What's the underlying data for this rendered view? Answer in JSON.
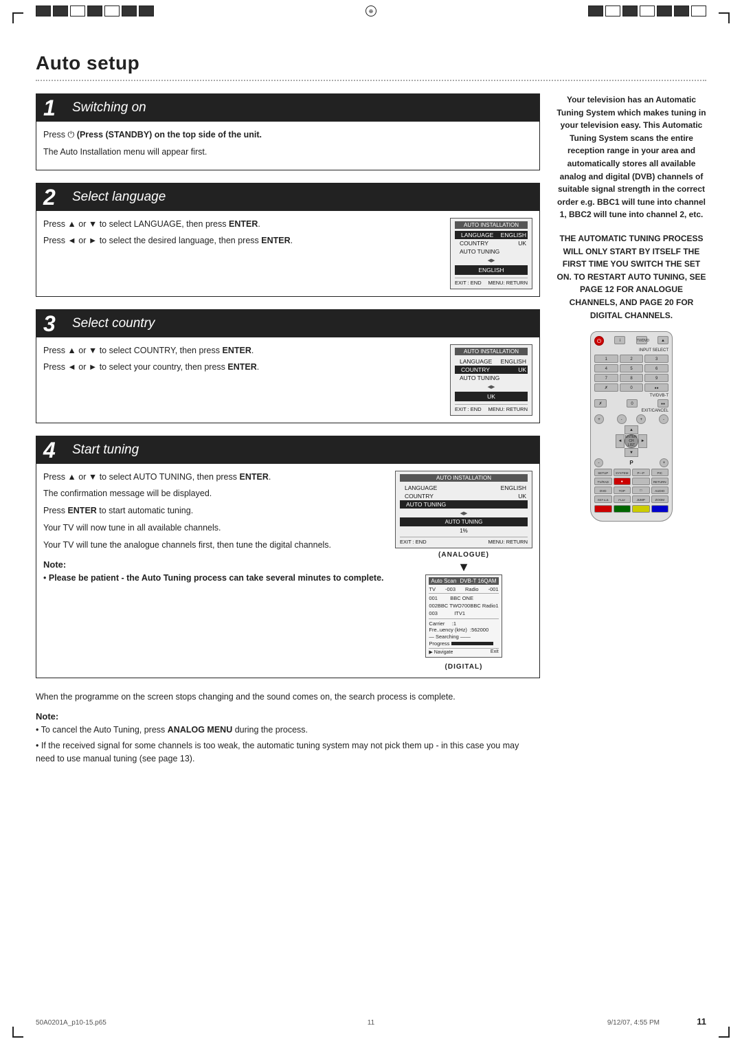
{
  "page": {
    "title": "Auto setup",
    "page_number": "11",
    "footer_left": "50A0201A_p10-15.p65",
    "footer_center": "11",
    "footer_right_date": "9/12/07, 4:55 PM"
  },
  "steps": [
    {
      "number": "1",
      "title": "Switching on",
      "text_lines": [
        "Press  (STANDBY) on the top side of the unit.",
        "The Auto Installation menu will appear first."
      ]
    },
    {
      "number": "2",
      "title": "Select language",
      "text_lines": [
        "Press ▲ or ▼ to select LANGUAGE, then press ENTER.",
        "Press ◄ or ► to select the desired language, then press ENTER."
      ],
      "screen": {
        "title": "AUTO INSTALLATION",
        "rows": [
          {
            "label": "LANGUAGE",
            "value": "ENGLISH",
            "active": true
          },
          {
            "label": "COUNTRY",
            "value": "UK",
            "active": false
          },
          {
            "label": "AUTO TUNING",
            "value": "",
            "active": false
          }
        ],
        "selection": "ENGLISH",
        "footer": [
          "EXIT : END",
          "MENU: RETURN"
        ]
      }
    },
    {
      "number": "3",
      "title": "Select country",
      "text_lines": [
        "Press ▲ or ▼ to select COUNTRY, then press ENTER.",
        "Press ◄ or ► to select your country, then press ENTER."
      ],
      "screen": {
        "title": "AUTO INSTALLATION",
        "rows": [
          {
            "label": "LANGUAGE",
            "value": "ENGLISH",
            "active": false
          },
          {
            "label": "COUNTRY",
            "value": "UK",
            "active": true
          },
          {
            "label": "AUTO TUNING",
            "value": "",
            "active": false
          }
        ],
        "selection": "UK",
        "footer": [
          "EXIT : END",
          "MENU: RETURN"
        ]
      }
    },
    {
      "number": "4",
      "title": "Start tuning",
      "text_lines_before": [
        "Press ▲ or ▼ to select AUTO TUNING, then press ENTER.",
        "The confirmation message will be displayed.",
        "Press ENTER to start automatic tuning.",
        "Your TV will now tune in all available channels.",
        "Your TV will tune the analogue channels first, then tune the digital channels."
      ],
      "note_title": "Note:",
      "note_items": [
        "Please be patient - the Auto Tuning process can take several minutes to complete."
      ],
      "screen_step4": {
        "title": "AUTO INSTALLATION",
        "rows": [
          {
            "label": "LANGUAGE",
            "value": "ENGLISH",
            "active": false
          },
          {
            "label": "COUNTRY",
            "value": "UK",
            "active": false
          },
          {
            "label": "AUTO TUNING",
            "value": "",
            "active": true
          }
        ],
        "autotuning_bar": "AUTO TUNING",
        "percent": "1%",
        "footer": [
          "EXIT : END",
          "MENU: RETURN"
        ]
      },
      "analogue_label": "(ANALOGUE)",
      "digital_label": "(DIGITAL)",
      "autoscan": {
        "title": "Auto Scan",
        "subtitle": "DVB-T 16QAM",
        "cols": [
          "TV",
          "-003",
          "Radio",
          "-001"
        ],
        "rows": [
          [
            "001",
            "BBC ONE",
            "",
            ""
          ],
          [
            "002",
            "BBC TWO",
            "700",
            "BBC Radio1"
          ],
          [
            "003",
            "ITV1",
            "",
            ""
          ]
        ],
        "carrier": "Carrier         :1",
        "frequency": "Fre..uency (kHz)  :562000",
        "searching": "Searching",
        "progress_label": "Progress",
        "navigate": "Navigate",
        "exit_label": "Exit"
      }
    }
  ],
  "bottom_notes": {
    "title": "Note:",
    "items": [
      "To cancel the Auto Tuning, press ANALOG MENU during the process.",
      "If the received signal for some channels is too weak, the automatic tuning system may not pick them up - in this case you may need to use manual tuning (see page 13)."
    ],
    "text_after": "When the programme on the screen stops changing and the sound comes on, the search process is complete."
  },
  "right_col": {
    "description": "Your television has an Automatic Tuning System which makes tuning in your television easy. This Automatic Tuning System scans the entire reception range in your area and automatically stores all available analog and digital (DVB) channels of suitable signal strength in the correct order e.g. BBC1 will tune into channel 1, BBC2 will tune into channel 2, etc.",
    "bold_text": "THE AUTOMATIC TUNING PROCESS WILL ONLY START BY ITSELF THE FIRST TIME YOU SWITCH THE SET ON. TO RESTART AUTO TUNING, SEE PAGE 12 FOR ANALOGUE CHANNELS, AND PAGE 20 FOR DIGITAL CHANNELS.",
    "remote_buttons": {
      "top": [
        "TV/DVD",
        "▲"
      ],
      "row1": [
        "●",
        "i",
        "TV/DVD",
        "▲"
      ],
      "numpad": [
        "1",
        "2",
        "3",
        "4",
        "5",
        "6",
        "7",
        "8",
        "9",
        "✗",
        "0",
        "●●"
      ],
      "nav_labels": [
        "INPUT SELECT",
        "TV/DVB-T",
        "EXIT/CANCEL"
      ],
      "dpad_center": [
        "ENTER/",
        "CH LIST"
      ],
      "small_rows": [
        [
          "SETUP ANALOG MEM",
          "SYSTEM MENU",
          "P—P SIZE",
          "PICTURE SIZE"
        ],
        [
          "TV/RADIO",
          "●",
          "",
          "RETURN"
        ],
        [
          "DVD MENU",
          "TOP MENU",
          "□",
          "AUDIO"
        ],
        [
          "REPEAT A-B",
          "PLAY MODE",
          "JUMP",
          "ZOOM"
        ]
      ]
    }
  }
}
